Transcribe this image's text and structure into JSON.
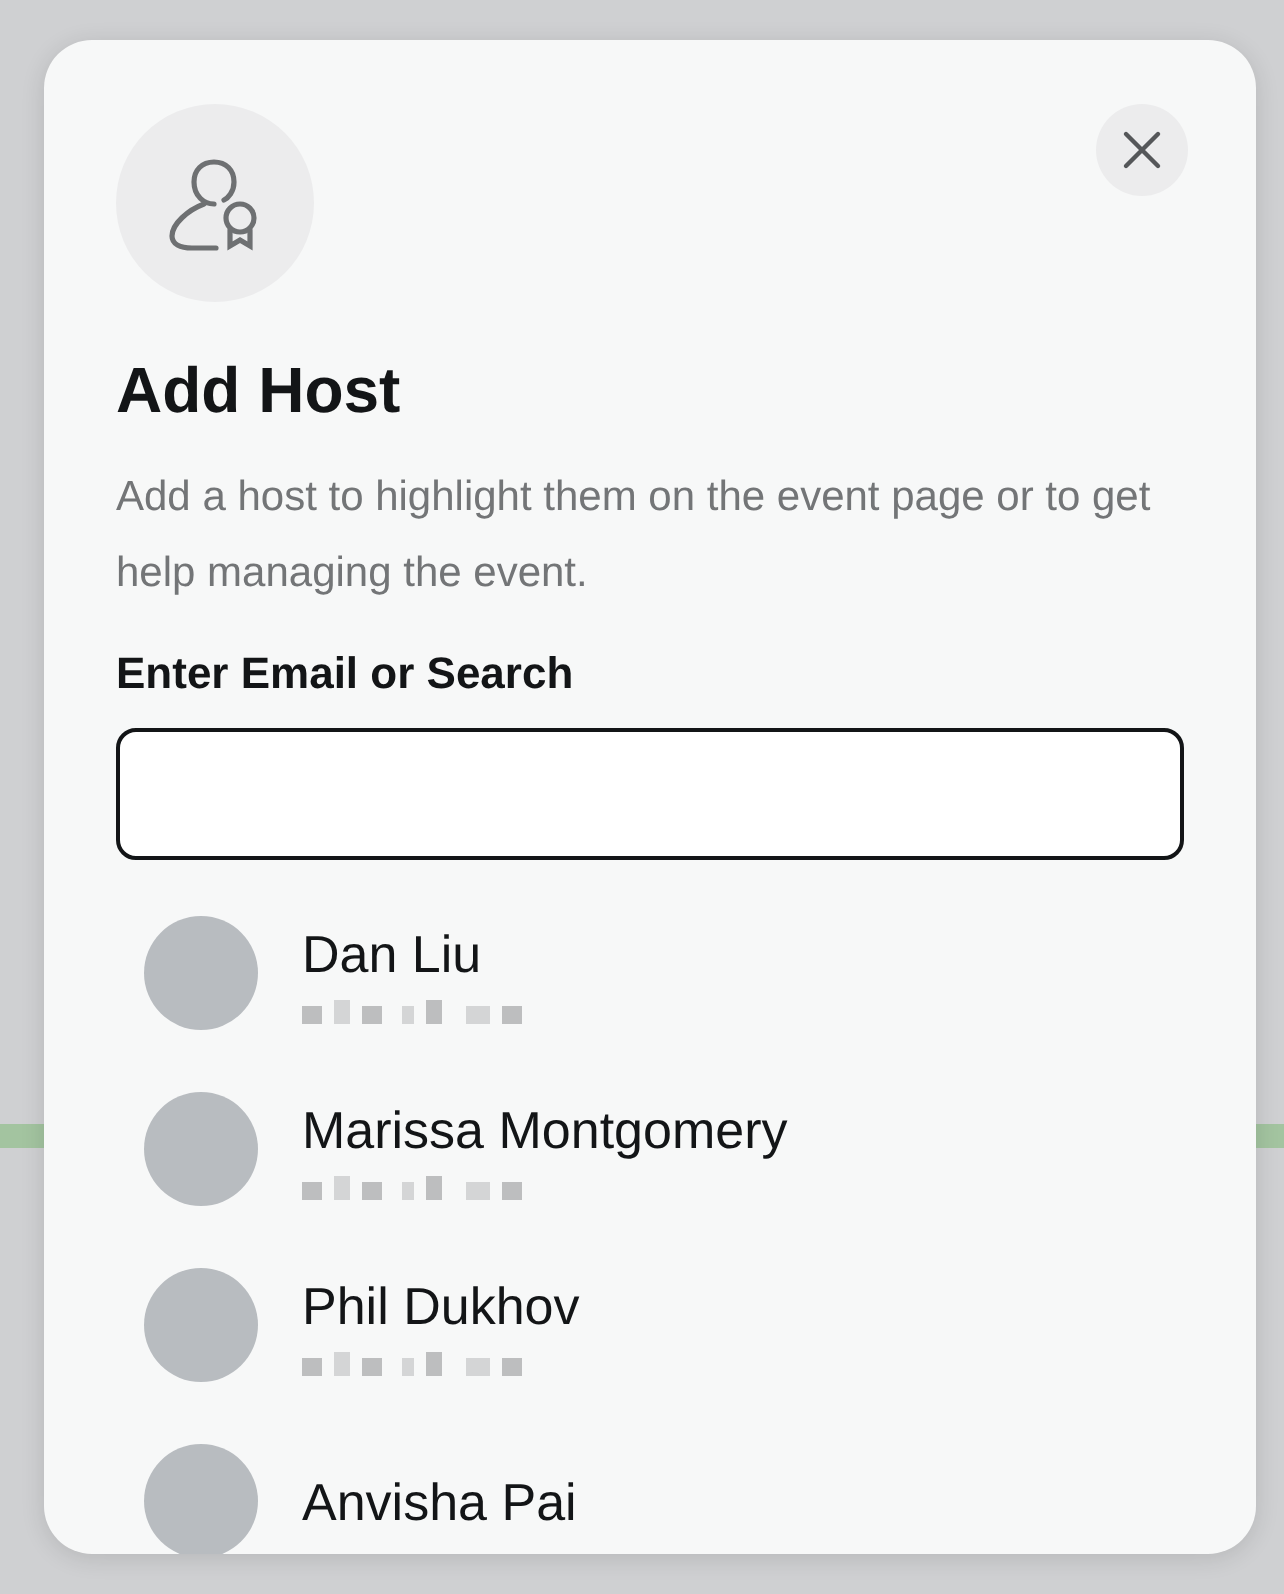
{
  "dialog": {
    "title": "Add Host",
    "description": "Add a host to highlight them on the event page or to get help managing the event.",
    "field": {
      "label": "Enter Email or Search"
    }
  },
  "hosts": [
    {
      "name": "Dan Liu"
    },
    {
      "name": "Marissa Montgomery"
    },
    {
      "name": "Phil Dukhov"
    },
    {
      "name": "Anvisha Pai"
    }
  ]
}
